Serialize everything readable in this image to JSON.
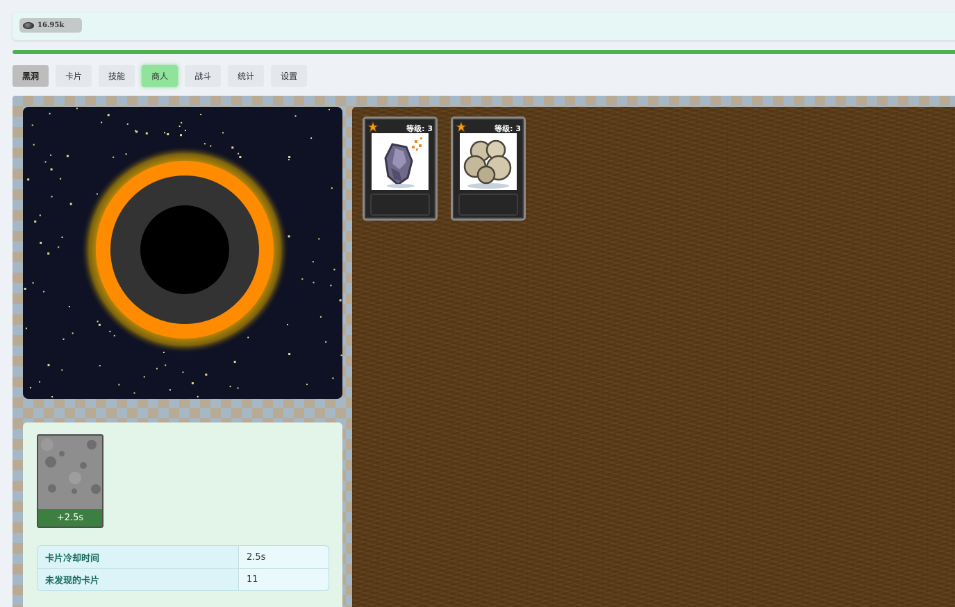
{
  "resources": [
    {
      "icon": "stone-icon",
      "amount": "16.95k"
    }
  ],
  "progress": {
    "fraction": 1.0,
    "color": "#4caf50"
  },
  "tabs": [
    {
      "label": "黑洞",
      "state": "active"
    },
    {
      "label": "卡片",
      "state": "normal"
    },
    {
      "label": "技能",
      "state": "normal"
    },
    {
      "label": "商人",
      "state": "highlighted"
    },
    {
      "label": "战斗",
      "state": "normal"
    },
    {
      "label": "统计",
      "state": "normal"
    },
    {
      "label": "设置",
      "state": "normal"
    }
  ],
  "board": {
    "cards": [
      {
        "level_label": "等级: 3",
        "icon": "ore-crystal-icon",
        "rarity_icon": "star-icon"
      },
      {
        "level_label": "等级: 3",
        "icon": "rock-pile-icon",
        "rarity_icon": "star-icon"
      }
    ]
  },
  "pending_card": {
    "timer": "+2.5s",
    "icon": "rock-texture-icon"
  },
  "stats": [
    {
      "label": "卡片冷却时间",
      "value": "2.5s"
    },
    {
      "label": "未发现的卡片",
      "value": "11"
    }
  ],
  "colors": {
    "accent_green": "#4caf50",
    "merchant_tab": "#8fe39a",
    "black_hole_ring": "#ff8c00",
    "board_wood": "#5a3b17"
  }
}
